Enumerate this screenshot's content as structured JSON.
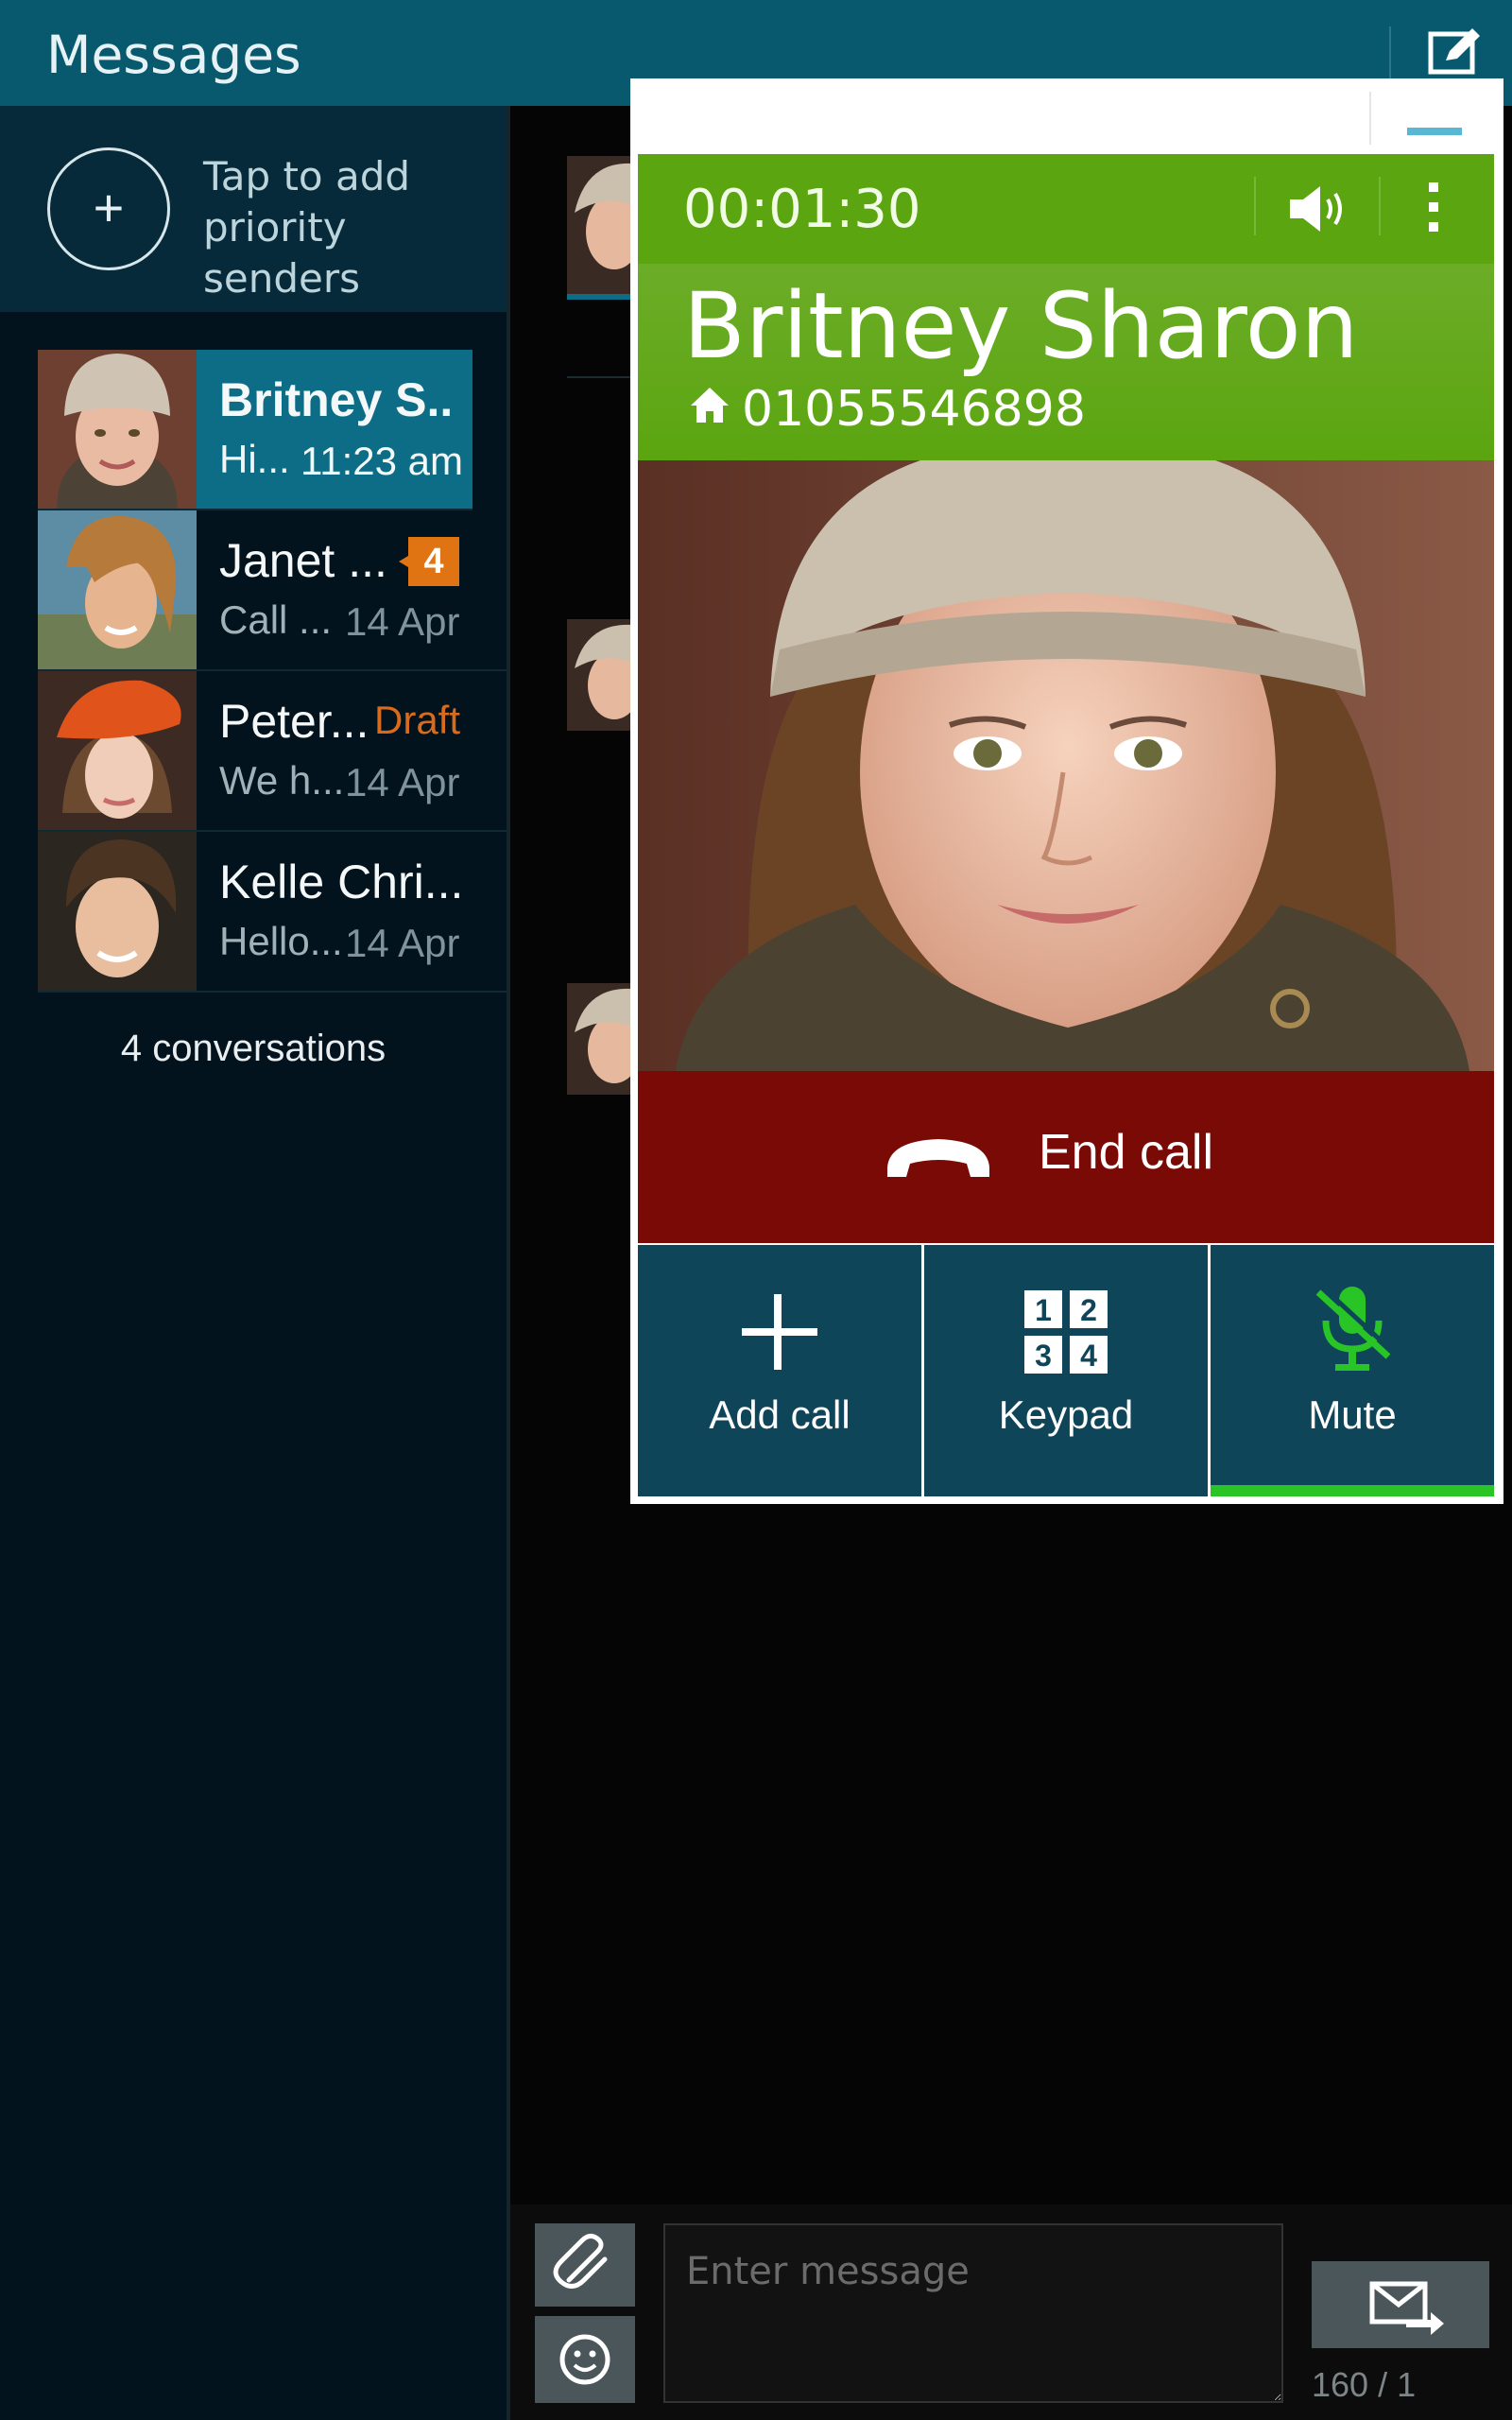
{
  "header": {
    "title": "Messages",
    "compose_icon": "compose-icon"
  },
  "priority": {
    "add_symbol": "+",
    "text": "Tap to add priority senders"
  },
  "conversations": [
    {
      "name": "Britney S..",
      "preview": "Hi...",
      "time": "11:23 am",
      "selected": true
    },
    {
      "name": "Janet ...",
      "preview": "Call ...",
      "time": "14 Apr",
      "badge": "4"
    },
    {
      "name": "Peter...",
      "preview": "We h...",
      "time": "14 Apr",
      "draft": "Draft"
    },
    {
      "name": "Kelle Chri...",
      "preview": "Hello...",
      "time": "14 Apr"
    }
  ],
  "conversation_count": "4 conversations",
  "call": {
    "timer": "00:01:30",
    "contact_name": "Britney Sharon",
    "phone": "01055546898",
    "end_call_label": "End call",
    "buttons": {
      "add_call": "Add call",
      "keypad": "Keypad",
      "mute": "Mute"
    },
    "keypad_digits": [
      "1",
      "2",
      "3",
      "4"
    ]
  },
  "composer": {
    "placeholder": "Enter message",
    "counter": "160 / 1"
  },
  "colors": {
    "topbar": "#08596e",
    "call_green": "#5ba510",
    "end_call": "#7a0a05",
    "mute_active": "#29c425",
    "badge": "#e07312"
  }
}
